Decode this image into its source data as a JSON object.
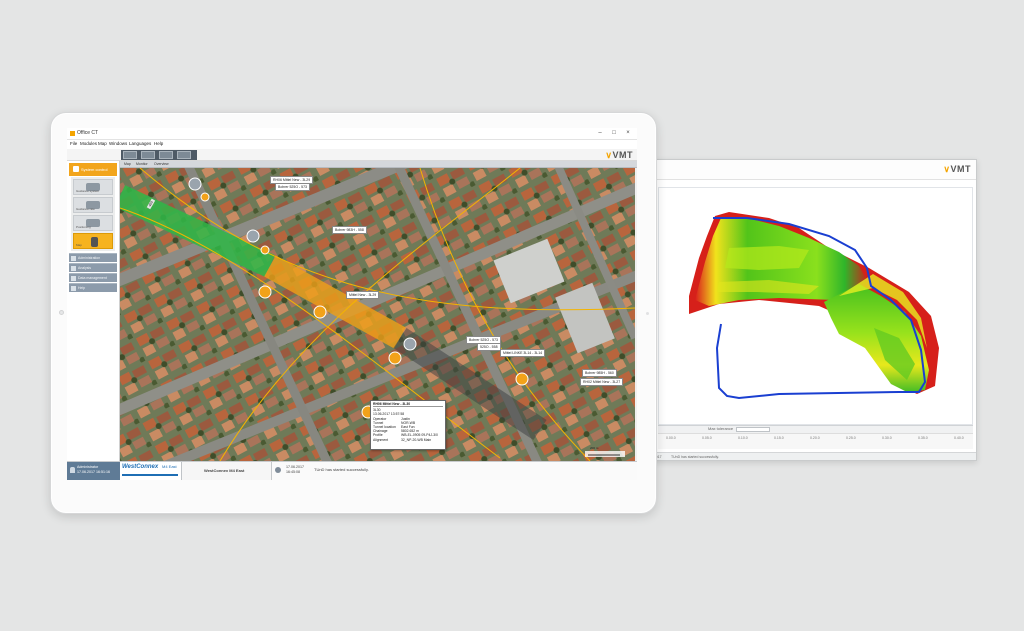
{
  "app": {
    "title": "Office CT",
    "menu": [
      "File",
      "Modules",
      "Map",
      "Windows",
      "Languages",
      "Help"
    ],
    "brand_logo": "VMT",
    "accent_color": "#f2a51c"
  },
  "left_nav": {
    "active_item": "System control",
    "sub_items": [
      "Guidance system",
      "Guidance rate",
      "Positioning",
      "Map"
    ],
    "items": [
      "Administration",
      "Analysis",
      "Data management",
      "Help"
    ]
  },
  "map_tabs": [
    "Map",
    "Monitor",
    "Overview"
  ],
  "map_callouts": [
    {
      "text": "RH06 Mittel New - 3L29"
    },
    {
      "text": "Bohrer 525O - 573"
    },
    {
      "text": "Bohrer 983H - 558"
    },
    {
      "text": "Mittel New - 3L29"
    },
    {
      "text": "Bohrer 525O - 573"
    },
    {
      "text": "525O - 558"
    },
    {
      "text": "Mittel LINKE 3L14 - 3L14"
    },
    {
      "text": "Bohrer 985H - 560"
    },
    {
      "text": "RH02 Mittel New - 3L27"
    }
  ],
  "map_labels": [
    "400",
    "200 m"
  ],
  "popup": {
    "title": "RH06 Mittel New - 3L30",
    "rows": [
      {
        "key": "Operator",
        "value": "Justin"
      },
      {
        "key": "Tunnel",
        "value": "NOR-WB"
      },
      {
        "key": "Tunnel location",
        "value": "East Fun"
      },
      {
        "key": "Chainage",
        "value": "5802.652 m"
      },
      {
        "key": "Profile",
        "value": "WB-EL-0905 09-P4J-3/0"
      },
      {
        "key": "Alignment",
        "value": "32_NP-20-WB Main"
      }
    ],
    "first_lines": [
      "3L30",
      "13.06.2017 13:57:58"
    ]
  },
  "statusbar": {
    "user_role": "Administrator",
    "user_date": "17.06.2017 16:51:16",
    "brand": "WestConnex",
    "brand_sub": "M4 East",
    "project": "WestConnex M4 East",
    "msg_date": "17.06.2017",
    "msg_time": "16:45:08",
    "message": "TUnD has started successfully."
  },
  "monitor": {
    "brand_logo": "VMT",
    "toolbar_label": "Max tolerance",
    "ruler_ticks": [
      "0.00.0",
      "0.05.0",
      "0.10.0",
      "0.15.0",
      "0.20.0",
      "0.25.0",
      "0.30.0",
      "0.35.0",
      "0.40.0"
    ],
    "status_date": "16.06.2017",
    "status_message": "TUnD has started successfully."
  }
}
